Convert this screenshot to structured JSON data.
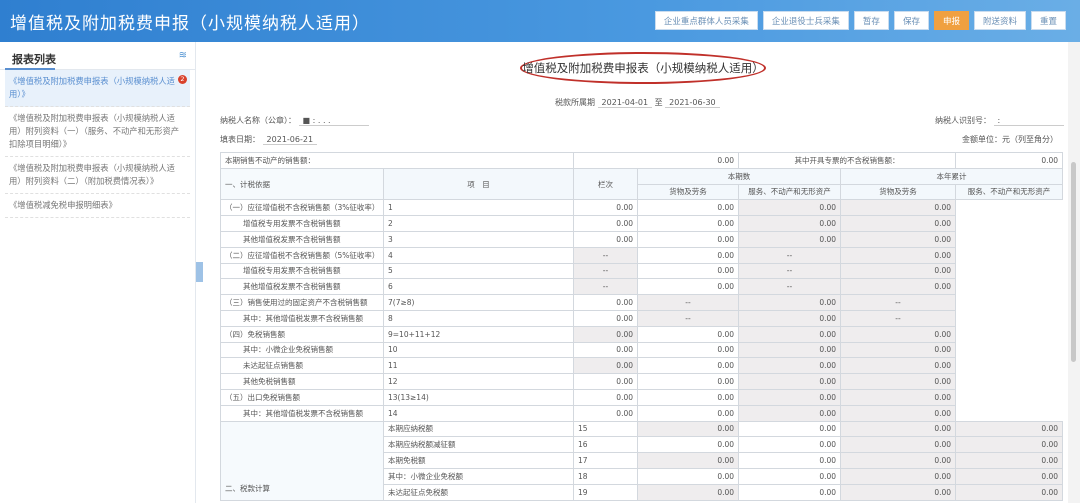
{
  "header": {
    "title": "增值税及附加税费申报（小规模纳税人适用）",
    "buttons": [
      "企业重点群体人员采集",
      "企业退役士兵采集",
      "暂存",
      "保存",
      "申报",
      "附送资料",
      "重置"
    ],
    "highlight_index": 4
  },
  "sidebar": {
    "title": "报表列表",
    "badge": "2",
    "items": [
      "《增值税及附加税费申报表（小规模纳税人适用）》",
      "《增值税及附加税费申报表（小规模纳税人适用）附列资料（一）（服务、不动产和无形资产扣除项目明细）》",
      "《增值税及附加税费申报表（小规模纳税人适用）附列资料（二）（附加税费情况表）》",
      "《增值税减免税申报明细表》"
    ]
  },
  "form": {
    "title": "增值税及附加税费申报表（小规模纳税人适用）",
    "period_label": "税款所属期",
    "period_from": "2021-04-01",
    "period_to_label": "至",
    "period_to": "2021-06-30",
    "taxpayer_name_label": "纳税人名称（公章）：",
    "taxpayer_name": "■ :  .  .  .",
    "taxpayer_id_label": "纳税人识别号：",
    "taxpayer_id": ":",
    "fill_date_label": "填表日期：",
    "fill_date": "2021-06-21",
    "unit": "金额单位：元（列至角分）"
  },
  "table": {
    "top_left_label": "本期销售不动产的销售额：",
    "top_left_value": "0.00",
    "top_right_label": "其中开具专票的不含税销售额：",
    "top_right_value": "0.00",
    "col_item": "项　目",
    "col_no": "栏次",
    "col_current": "本期数",
    "col_year": "本年累计",
    "sub_goods": "货物及劳务",
    "sub_services": "服务、不动产和无形资产",
    "sections": [
      "一、计税依据",
      "二、税款计算"
    ],
    "rows": [
      [
        "（一）应征增值税不含税销售额（3%征收率）",
        "1",
        "0.00",
        "0.00",
        "0.00",
        "0.00"
      ],
      [
        "增值税专用发票不含税销售额",
        "2",
        "0.00",
        "0.00",
        "0.00",
        "0.00"
      ],
      [
        "其他增值税发票不含税销售额",
        "3",
        "0.00",
        "0.00",
        "0.00",
        "0.00"
      ],
      [
        "（二）应征增值税不含税销售额（5%征收率）",
        "4",
        "--",
        "0.00",
        "--",
        "0.00"
      ],
      [
        "增值税专用发票不含税销售额",
        "5",
        "--",
        "0.00",
        "--",
        "0.00"
      ],
      [
        "其他增值税发票不含税销售额",
        "6",
        "--",
        "0.00",
        "--",
        "0.00"
      ],
      [
        "（三）销售使用过的固定资产不含税销售额",
        "7(7≥8)",
        "0.00",
        "--",
        "0.00",
        "--"
      ],
      [
        "其中：其他增值税发票不含税销售额",
        "8",
        "0.00",
        "--",
        "0.00",
        "--"
      ],
      [
        "（四）免税销售额",
        "9=10+11+12",
        "0.00",
        "0.00",
        "0.00",
        "0.00"
      ],
      [
        "其中：小微企业免税销售额",
        "10",
        "0.00",
        "0.00",
        "0.00",
        "0.00"
      ],
      [
        "未达起征点销售额",
        "11",
        "0.00",
        "0.00",
        "0.00",
        "0.00"
      ],
      [
        "其他免税销售额",
        "12",
        "0.00",
        "0.00",
        "0.00",
        "0.00"
      ],
      [
        "（五）出口免税销售额",
        "13(13≥14)",
        "0.00",
        "0.00",
        "0.00",
        "0.00"
      ],
      [
        "其中：其他增值税发票不含税销售额",
        "14",
        "0.00",
        "0.00",
        "0.00",
        "0.00"
      ],
      [
        "本期应纳税额",
        "15",
        "0.00",
        "0.00",
        "0.00",
        "0.00"
      ],
      [
        "本期应纳税额减征额",
        "16",
        "0.00",
        "0.00",
        "0.00",
        "0.00"
      ],
      [
        "本期免税额",
        "17",
        "0.00",
        "0.00",
        "0.00",
        "0.00"
      ],
      [
        "其中：小微企业免税额",
        "18",
        "0.00",
        "0.00",
        "0.00",
        "0.00"
      ],
      [
        "未达起征点免税额",
        "19",
        "0.00",
        "0.00",
        "0.00",
        "0.00"
      ]
    ]
  }
}
